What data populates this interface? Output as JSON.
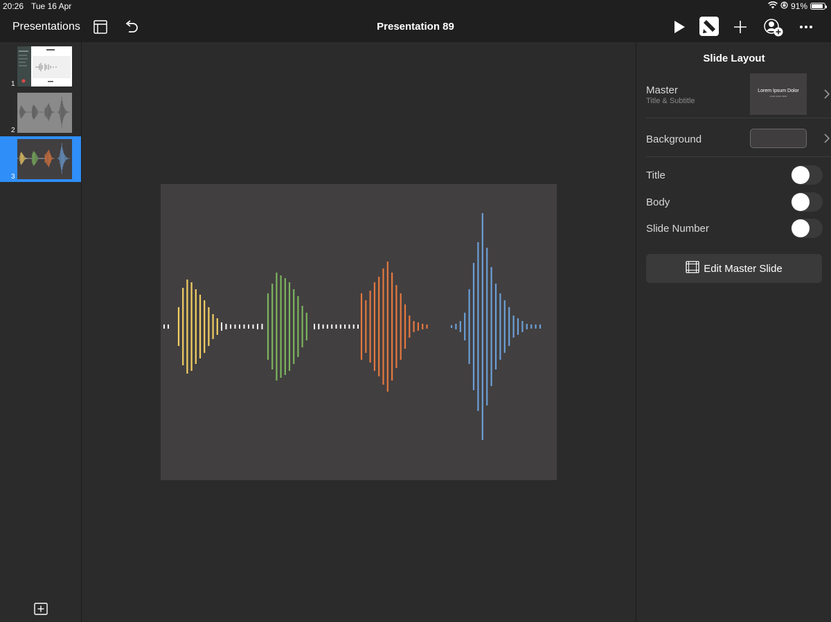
{
  "status": {
    "time": "20:26",
    "date": "Tue 16 Apr",
    "battery": "91%",
    "battery_level": 0.91
  },
  "toolbar": {
    "back_label": "Presentations",
    "document_title": "Presentation 89"
  },
  "navigator": {
    "slides": [
      {
        "number": "1",
        "selected": false
      },
      {
        "number": "2",
        "selected": false
      },
      {
        "number": "3",
        "selected": true
      }
    ]
  },
  "inspector": {
    "title": "Slide Layout",
    "master": {
      "label": "Master",
      "value": "Title & Subtitle",
      "thumb_title": "Lorem Ipsum Dolor",
      "thumb_subtitle": "Lorem ipsum dolor"
    },
    "background": {
      "label": "Background",
      "color": "#3f3d3e"
    },
    "toggles": [
      {
        "label": "Title",
        "on": false
      },
      {
        "label": "Body",
        "on": false
      },
      {
        "label": "Slide Number",
        "on": false
      }
    ],
    "edit_master_label": "Edit Master Slide"
  },
  "colors": {
    "accent": "#2f8ef7",
    "slide_bg": "#423f40",
    "wave_yellow": "#f2cf63",
    "wave_green": "#7cb45e",
    "wave_orange": "#e4783e",
    "wave_blue": "#6b9fd6",
    "wave_white": "#ffffff"
  },
  "icons": {
    "layout": "sidebar-layout-icon",
    "undo": "undo-icon",
    "play": "play-icon",
    "format": "paintbrush-icon",
    "insert": "plus-icon",
    "collaborate": "add-person-icon",
    "more": "ellipsis-icon",
    "add_slide": "add-slide-icon",
    "chevron": "chevron-right-icon"
  }
}
